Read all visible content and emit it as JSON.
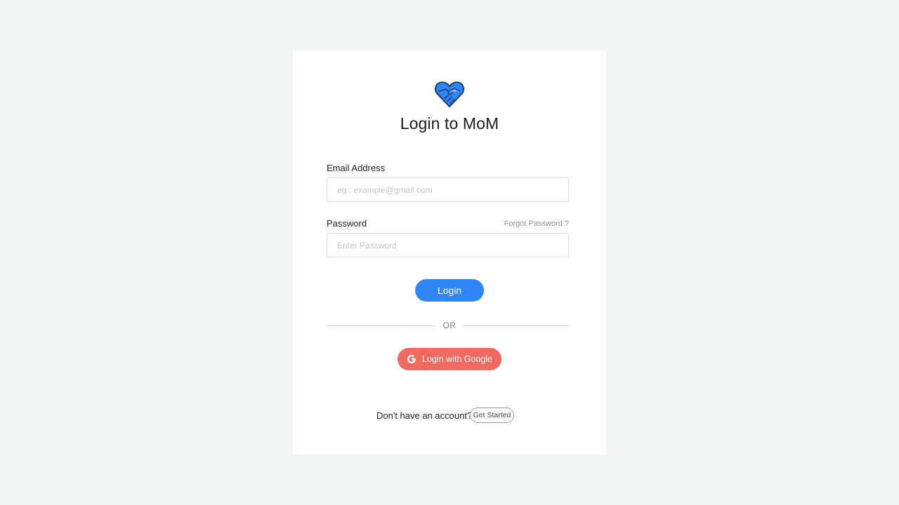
{
  "brand": {
    "logo_icon": "heart-handshake-icon",
    "logo_color": "#2f86f6"
  },
  "title": "Login to MoM",
  "email": {
    "label": "Email Address",
    "placeholder": "eg : example@gmail.com",
    "value": ""
  },
  "password": {
    "label": "Password",
    "placeholder": "Enter Password",
    "value": "",
    "forgot_link": "Forgot Password ?"
  },
  "login_button": "Login",
  "divider_text": "OR",
  "google_button": {
    "label": "Login with Google",
    "icon": "google-g-icon",
    "color": "#f06a62"
  },
  "signup": {
    "prompt": "Don't have an account?",
    "button": "Get Started"
  },
  "colors": {
    "background": "#f2f5f6",
    "card": "#ffffff",
    "primary": "#2f86f6",
    "google": "#f06a62"
  }
}
